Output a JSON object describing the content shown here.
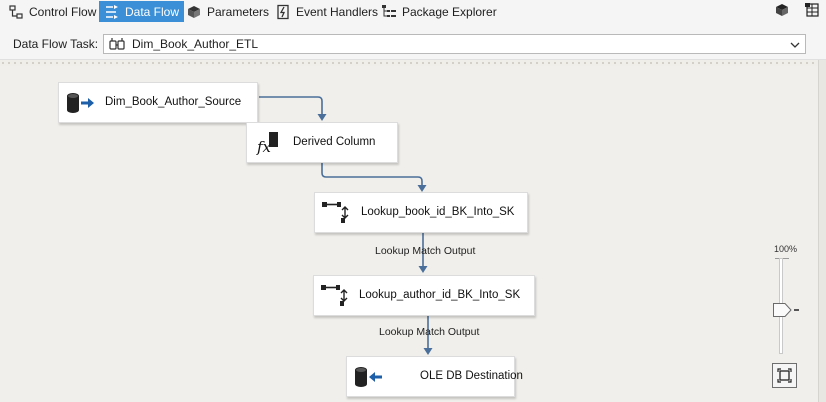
{
  "tabs": [
    {
      "label": "Control Flow",
      "icon": "control-flow-icon",
      "active": false
    },
    {
      "label": "Data Flow",
      "icon": "data-flow-icon",
      "active": true
    },
    {
      "label": "Parameters",
      "icon": "parameters-icon",
      "active": false
    },
    {
      "label": "Event Handlers",
      "icon": "event-handlers-icon",
      "active": false
    },
    {
      "label": "Package Explorer",
      "icon": "package-explorer-icon",
      "active": false
    }
  ],
  "toolbar_right_icons": [
    "package-icon",
    "variables-grid-icon"
  ],
  "task": {
    "caption": "Data Flow Task:",
    "value": "Dim_Book_Author_ETL"
  },
  "nodes": [
    {
      "label": "Dim_Book_Author_Source",
      "icon": "source-database-icon"
    },
    {
      "label": "Derived Column",
      "icon": "derived-column-fx-icon"
    },
    {
      "label": "Lookup_book_id_BK_Into_SK",
      "icon": "lookup-icon"
    },
    {
      "label": "Lookup_author_id_BK_Into_SK",
      "icon": "lookup-icon"
    },
    {
      "label": "OLE DB Destination",
      "icon": "destination-database-icon"
    }
  ],
  "path_labels": [
    "Lookup Match Output",
    "Lookup Match Output"
  ],
  "zoom": {
    "label": "100%",
    "level": 1.0
  },
  "colors": {
    "active_tab": "#3a8fd6",
    "connector": "#4a6f9a",
    "canvas": "#f1efeb"
  }
}
